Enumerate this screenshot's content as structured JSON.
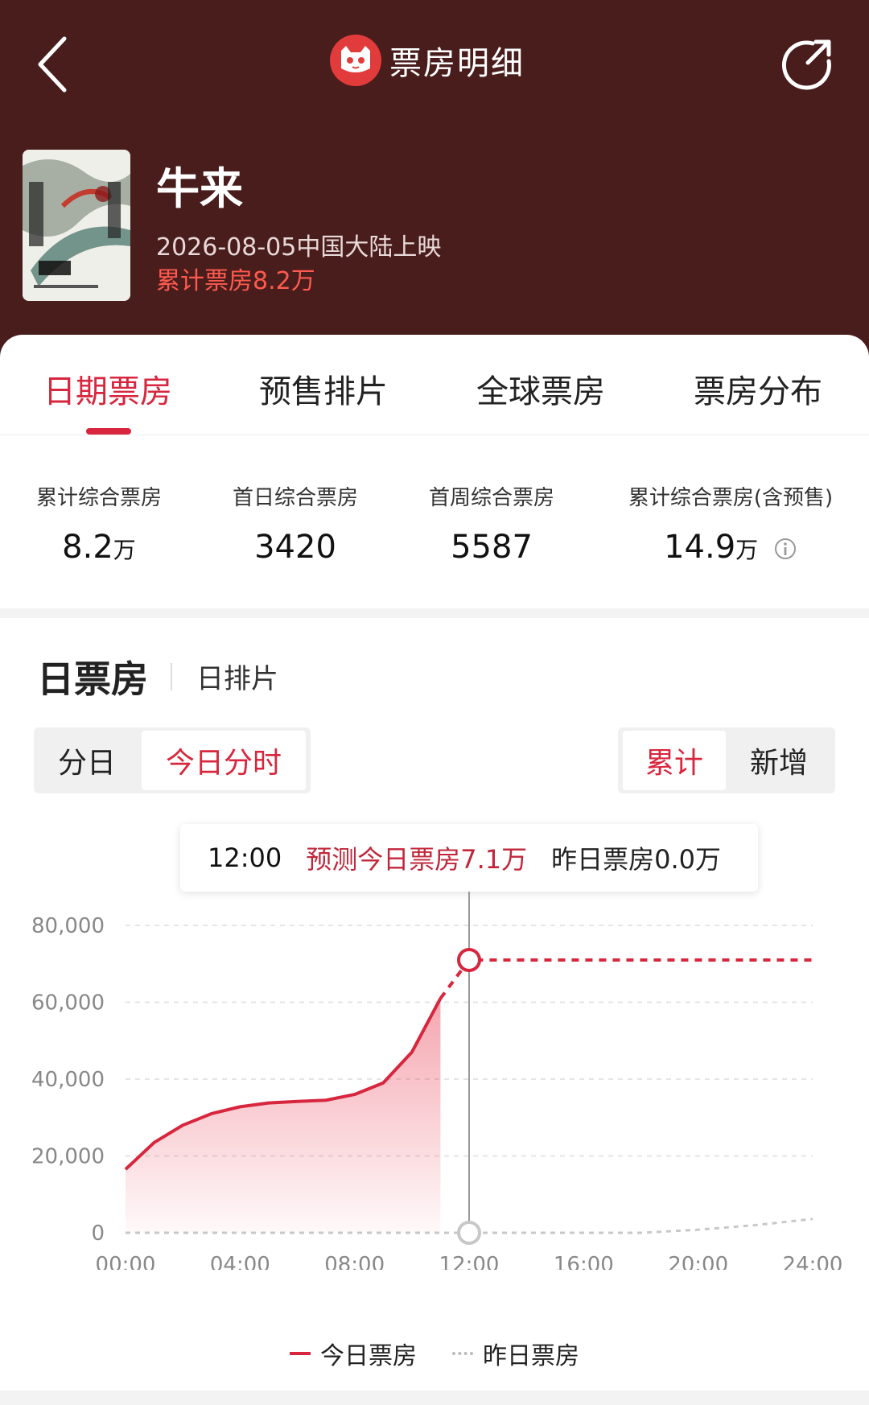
{
  "header": {
    "title": "票房明细",
    "movie_name": "牛来",
    "release": "2026-08-05中国大陆上映",
    "total_line": "累计票房8.2万"
  },
  "tabs": [
    {
      "label": "日期票房",
      "active": true
    },
    {
      "label": "预售排片",
      "active": false
    },
    {
      "label": "全球票房",
      "active": false
    },
    {
      "label": "票房分布",
      "active": false
    }
  ],
  "stats": [
    {
      "label": "累计综合票房",
      "value": "8.2",
      "unit": "万"
    },
    {
      "label": "首日综合票房",
      "value": "3420",
      "unit": ""
    },
    {
      "label": "首周综合票房",
      "value": "5587",
      "unit": ""
    },
    {
      "label": "累计综合票房(含预售)",
      "value": "14.9",
      "unit": "万"
    }
  ],
  "section": {
    "title": "日票房",
    "sub": "日排片"
  },
  "segments": {
    "left": [
      {
        "label": "分日",
        "on": false
      },
      {
        "label": "今日分时",
        "on": true
      }
    ],
    "right": [
      {
        "label": "累计",
        "on": true
      },
      {
        "label": "新增",
        "on": false
      }
    ]
  },
  "tooltip": {
    "time": "12:00",
    "predicted": "预测今日票房7.1万",
    "yesterday": "昨日票房0.0万"
  },
  "legend": {
    "today": "今日票房",
    "yesterday": "昨日票房"
  },
  "colors": {
    "header_bg": "#4a1d1d",
    "accent": "#d7263d"
  },
  "chart_data": {
    "type": "line",
    "x_ticks": [
      "00:00",
      "04:00",
      "08:00",
      "12:00",
      "16:00",
      "20:00",
      "24:00"
    ],
    "y_ticks": [
      "80,000",
      "60,000",
      "40,000",
      "20,000",
      "0"
    ],
    "ylim": [
      0,
      80000
    ],
    "xlim_hours": [
      0,
      24
    ],
    "series": [
      {
        "name": "今日票房",
        "style": "solid-area",
        "points": [
          [
            0,
            16500
          ],
          [
            1,
            23500
          ],
          [
            2,
            28000
          ],
          [
            3,
            31000
          ],
          [
            4,
            32800
          ],
          [
            5,
            33800
          ],
          [
            6,
            34200
          ],
          [
            7,
            34500
          ],
          [
            8,
            36000
          ],
          [
            9,
            39000
          ],
          [
            10,
            47000
          ],
          [
            11,
            61000
          ]
        ]
      },
      {
        "name": "今日票房",
        "style": "dashed-forecast",
        "points": [
          [
            11,
            61000
          ],
          [
            12,
            71000
          ],
          [
            24,
            71000
          ]
        ]
      },
      {
        "name": "昨日票房",
        "style": "dotted",
        "points": [
          [
            0,
            0
          ],
          [
            18,
            0
          ],
          [
            20,
            800
          ],
          [
            22,
            2000
          ],
          [
            24,
            3600
          ]
        ]
      }
    ],
    "marker_hour": 12
  }
}
